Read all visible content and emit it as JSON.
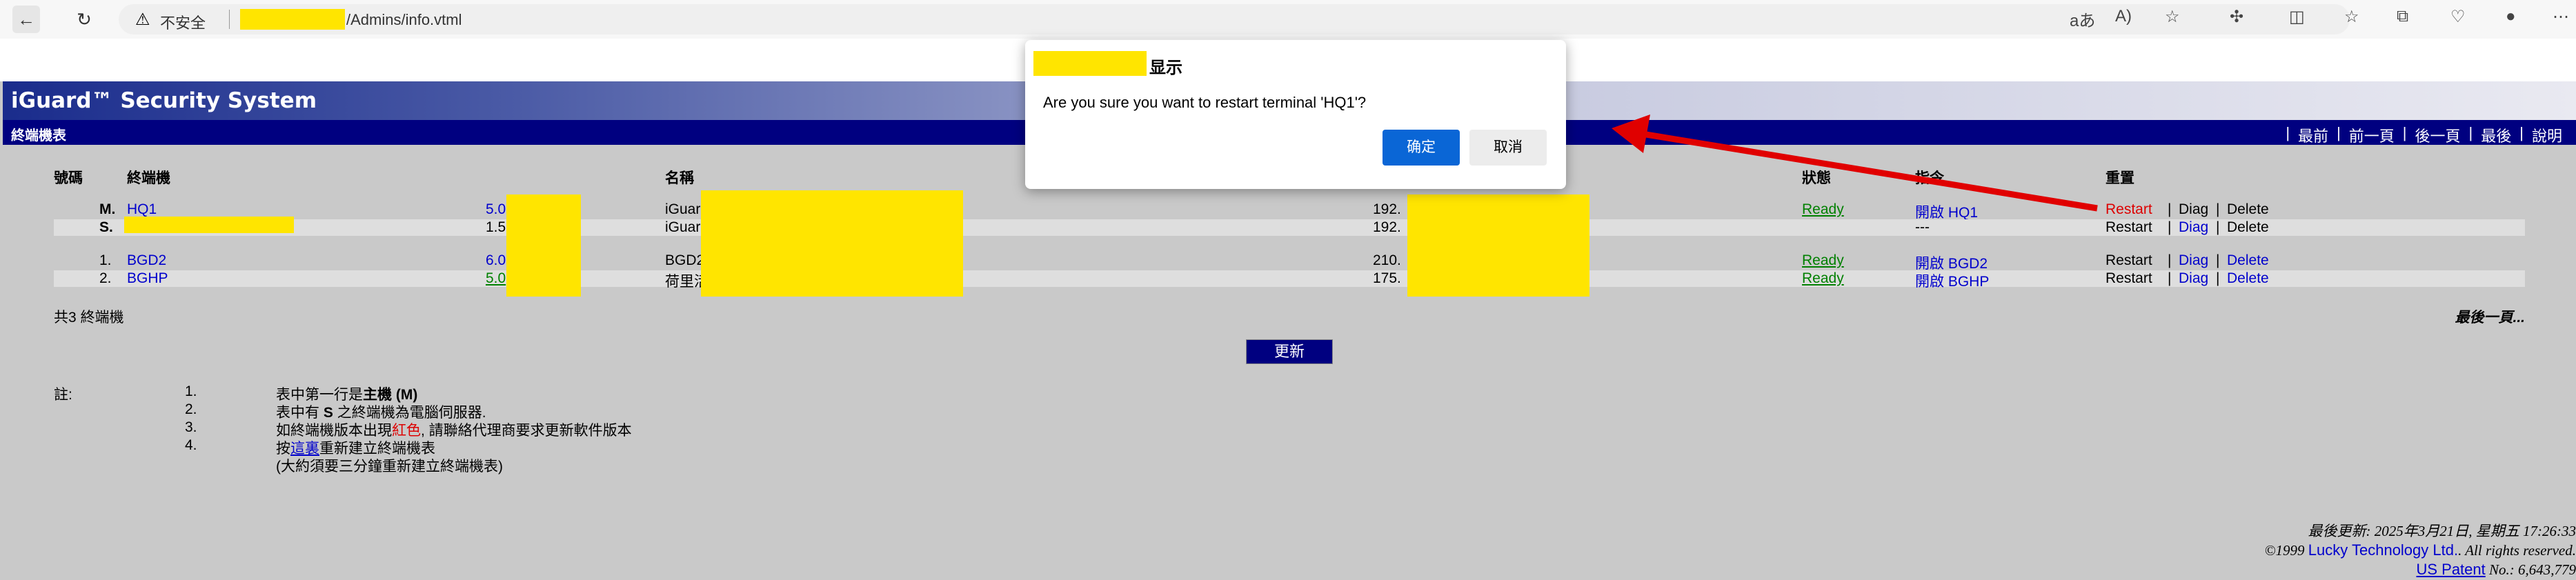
{
  "browser": {
    "security_label": "不安全",
    "url_path": "/Admins/info.vtml",
    "icons": [
      "back-icon",
      "reload-icon",
      "warning-icon",
      "read-aloud-icon",
      "text-size-icon",
      "favorite-star-icon",
      "extensions-icon",
      "split-screen-icon",
      "favorites-icon",
      "collections-icon",
      "browser-essentials-icon",
      "profile-icon",
      "more-icon",
      "sidebar-arrow-icon"
    ]
  },
  "banner": {
    "title": "iGuard™ Security System"
  },
  "bar": {
    "title": "終端機表",
    "nav": [
      "最前",
      "前一頁",
      "後一頁",
      "最後",
      "說明"
    ]
  },
  "table": {
    "headers": {
      "no": "號碼",
      "terminal": "終端機",
      "name": "名稱",
      "status": "狀態",
      "command": "指令",
      "reset": "重置"
    },
    "rows": [
      {
        "no": "M.",
        "terminal": "HQ1",
        "version": "5.0",
        "name": "iGuar",
        "ip": "192.",
        "status": "Ready",
        "command": "開啟 HQ1",
        "restart": "Restart",
        "diag": "Diag",
        "delete": "Delete"
      },
      {
        "no": "S.",
        "terminal": "",
        "version": "1.5",
        "name": "iGuar",
        "ip": "192.",
        "status": "",
        "command": "---",
        "restart": "Restart",
        "diag": "Diag",
        "delete": "Delete"
      },
      {
        "no": "1.",
        "terminal": "BGD2",
        "version": "6.0",
        "name": "BGD2",
        "ip": "210.",
        "status": "Ready",
        "command": "開啟 BGD2",
        "restart": "Restart",
        "diag": "Diag",
        "delete": "Delete"
      },
      {
        "no": "2.",
        "terminal": "BGHP",
        "version": "5.0",
        "name": "荷里活",
        "ip": "175.",
        "status": "Ready",
        "command": "開啟 BGHP",
        "restart": "Restart",
        "diag": "Diag",
        "delete": "Delete"
      }
    ],
    "separator": "|",
    "total": "共3 終端機",
    "last_page": "最後一頁..."
  },
  "refresh_label": "更新",
  "notes": {
    "label": "註:",
    "items": [
      {
        "num": "1.",
        "pre": "表中第一行是",
        "bold": "主機 (M)"
      },
      {
        "num": "2.",
        "pre": "表中有 ",
        "bold": "S",
        "post": " 之終端機為電腦伺服器."
      },
      {
        "num": "3.",
        "pre": "如終端機版本出現",
        "red": "紅色",
        "post": ", 請聯絡代理商要求更新軟件版本"
      },
      {
        "num": "4.",
        "pre": "按",
        "link": "這裏",
        "post": "重新建立終端機表"
      },
      {
        "num": "",
        "pre": "(大約須要三分鐘重新建立終端機表)"
      }
    ]
  },
  "footer": {
    "updated": "最後更新: 2025年3月21日, 星期五 17:26:33",
    "copyright_pre": "©1999 ",
    "company": "Lucky Technology Ltd.",
    "rights": ". All rights reserved.",
    "patent_link": "US Patent",
    "patent_no": " No.: 6,643,779"
  },
  "dialog": {
    "title": "显示",
    "message": "Are you sure you want to restart terminal 'HQ1'?",
    "ok": "确定",
    "cancel": "取消"
  },
  "colors": {
    "accent": "#000080",
    "status": "#008000",
    "link": "#0000cc",
    "warning": "#dd0000",
    "redaction": "#ffe500",
    "dialog_ok": "#0a66d6"
  }
}
